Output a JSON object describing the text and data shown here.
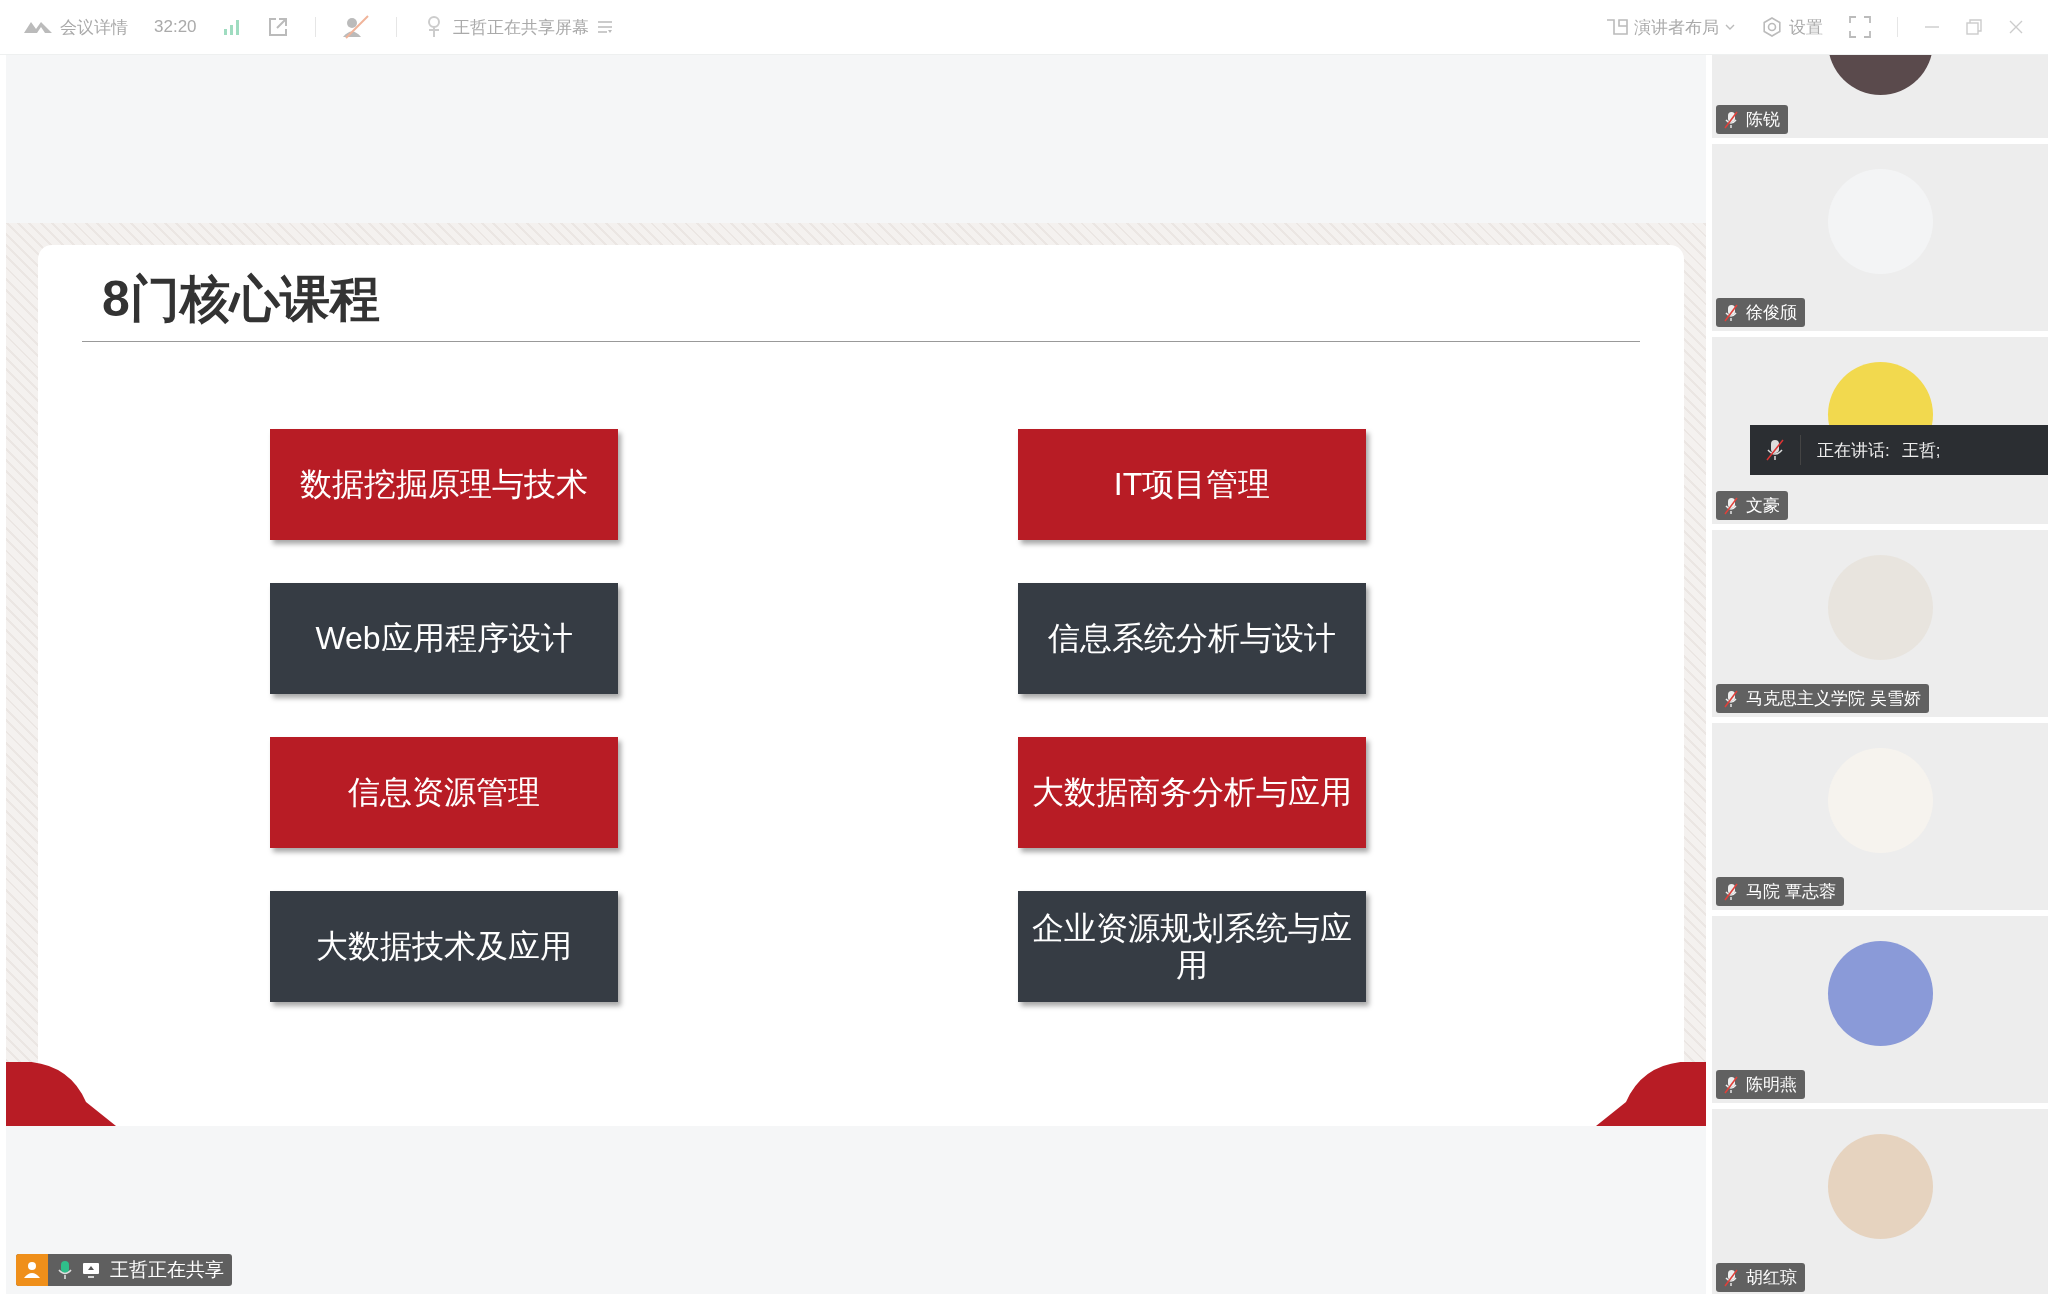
{
  "toolbar": {
    "meeting_details": "会议详情",
    "elapsed": "32:20",
    "sharing_status": "王哲正在共享屏幕",
    "layout": "演讲者布局",
    "settings": "设置"
  },
  "slide": {
    "title": "8门核心课程",
    "courses": [
      {
        "label": "数据挖掘原理与技术",
        "color": "#b81c25"
      },
      {
        "label": "IT项目管理",
        "color": "#b81c25"
      },
      {
        "label": "Web应用程序设计",
        "color": "#363c44"
      },
      {
        "label": "信息系统分析与设计",
        "color": "#363c44"
      },
      {
        "label": "信息资源管理",
        "color": "#b81c25"
      },
      {
        "label": "大数据商务分析与应用",
        "color": "#b81c25"
      },
      {
        "label": "大数据技术及应用",
        "color": "#363c44"
      },
      {
        "label": "企业资源规划系统与应用",
        "color": "#363c44"
      }
    ]
  },
  "participants": [
    {
      "name": "陈锐",
      "muted": true,
      "color": "#5a4a4c"
    },
    {
      "name": "徐俊颀",
      "muted": true,
      "color": "#f3f4f5"
    },
    {
      "name": "文豪",
      "muted": true,
      "color": "#f2d94e"
    },
    {
      "name": "马克思主义学院  吴雪娇",
      "muted": true,
      "color": "#e8e4de"
    },
    {
      "name": "马院 覃志蓉",
      "muted": true,
      "color": "#f6f3ee"
    },
    {
      "name": "陈明燕",
      "muted": true,
      "color": "#8a9ad8"
    },
    {
      "name": "胡红琼",
      "muted": true,
      "color": "#e6d3bf"
    }
  ],
  "speaking": {
    "label": "正在讲话:",
    "speaker": "王哲;",
    "muted": true
  },
  "share_badge": {
    "label": "王哲正在共享",
    "muted": false
  }
}
